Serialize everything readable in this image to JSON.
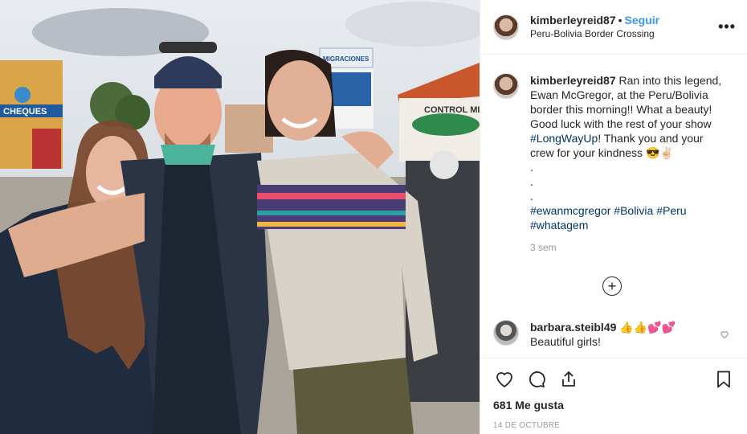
{
  "post": {
    "username": "kimberleyreid87",
    "separator": "•",
    "follow_label": "Seguir",
    "location": "Peru-Bolivia Border Crossing",
    "more_label": "•••"
  },
  "caption": {
    "username": "kimberleyreid87",
    "text_1": " Ran into this legend, Ewan McGregor, at the Peru/Bolivia border this morning!! What a beauty! Good luck with the rest of your show ",
    "tag_longwayup": "#LongWayUp",
    "text_2": "! Thank you and your crew for your kindness 😎✌🏻",
    "dots": [
      ".",
      ".",
      "."
    ],
    "tag_ewan": "#ewanmcgregor",
    "tag_bolivia": "#Bolivia",
    "tag_peru": "#Peru",
    "tag_whatagem": "#whatagem",
    "time": "3 sem"
  },
  "load_more": "+",
  "comment": {
    "username": "barbara.steibl49",
    "emojis": " 👍👍💕💕",
    "text": "Beautiful girls!",
    "like_icon": "heart-outline-icon"
  },
  "actions": {
    "like_icon": "heart-icon",
    "comment_icon": "comment-icon",
    "share_icon": "share-icon",
    "save_icon": "bookmark-icon",
    "likes": "681 Me gusta",
    "date": "14 DE OCTUBRE"
  },
  "photo": {
    "sign_1": "CHEQUES",
    "sign_2": "MIGRACIONES",
    "sign_3": "CONTROL MIGRA"
  },
  "colors": {
    "link": "#3897f0",
    "hashtag": "#003569",
    "muted": "#999999"
  }
}
